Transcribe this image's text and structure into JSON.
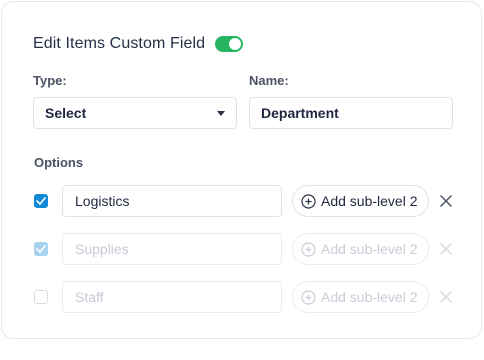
{
  "header": {
    "title": "Edit Items Custom Field",
    "enabled": true,
    "toggle_color": "#27b562"
  },
  "type_field": {
    "label": "Type:",
    "value": "Select"
  },
  "name_field": {
    "label": "Name:",
    "value": "Department"
  },
  "options": {
    "label": "Options",
    "add_sublevel_label": "Add sub-level 2",
    "items": [
      {
        "value": "Logistics",
        "checked": true,
        "enabled": true
      },
      {
        "value": "Supplies",
        "checked": true,
        "enabled": false
      },
      {
        "value": "Staff",
        "checked": false,
        "enabled": false
      }
    ]
  },
  "colors": {
    "checkbox_accent": "#138ad6",
    "text_primary": "#1f2740",
    "text_disabled": "#c5cad3"
  }
}
